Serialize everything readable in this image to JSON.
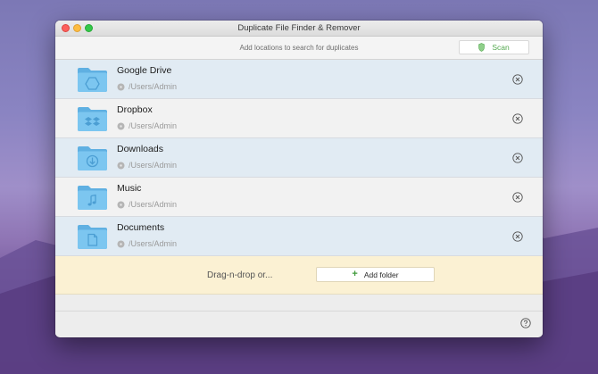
{
  "window": {
    "title": "Duplicate File Finder & Remover"
  },
  "toolbar": {
    "hint": "Add locations to search for duplicates",
    "scan_label": "Scan",
    "scan_icon": "shield-icon"
  },
  "locations": [
    {
      "name": "Google Drive",
      "path": "/Users/Admin",
      "icon": "google-drive-folder-icon",
      "badge": "drive"
    },
    {
      "name": "Dropbox",
      "path": "/Users/Admin",
      "icon": "dropbox-folder-icon",
      "badge": "dropbox"
    },
    {
      "name": "Downloads",
      "path": "/Users/Admin",
      "icon": "downloads-folder-icon",
      "badge": "download"
    },
    {
      "name": "Music",
      "path": "/Users/Admin",
      "icon": "music-folder-icon",
      "badge": "music"
    },
    {
      "name": "Documents",
      "path": "/Users/Admin",
      "icon": "documents-folder-icon",
      "badge": "document"
    }
  ],
  "dropzone": {
    "text": "Drag-n-drop or...",
    "add_folder_label": "Add folder"
  },
  "colors": {
    "accent_green": "#53a84e",
    "folder_blue": "#6fbde9",
    "row_highlight": "#e1ebf3",
    "dropzone_bg": "#fbf1d3"
  }
}
